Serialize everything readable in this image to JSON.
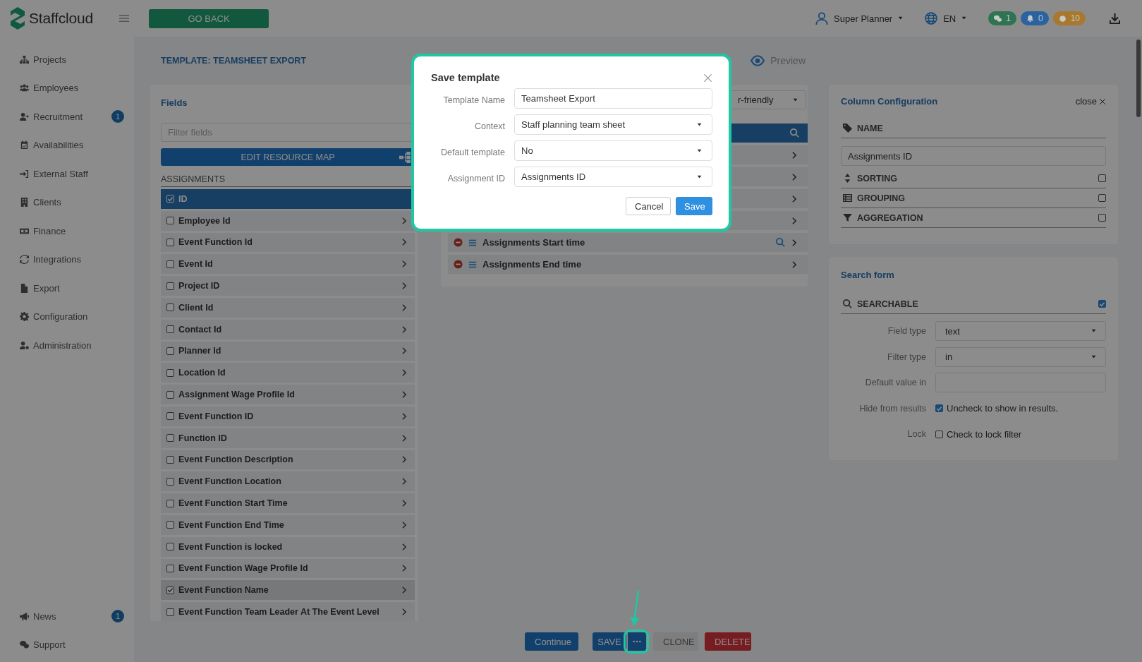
{
  "header": {
    "logo": "Staffcloud",
    "back_button": "GO BACK",
    "user": "Super Planner",
    "language": "EN",
    "counters": [
      {
        "kind": "chat",
        "label": "1",
        "color": "#2e7352"
      },
      {
        "kind": "bell",
        "label": "0",
        "color": "#2b62a0"
      },
      {
        "kind": "coin",
        "label": "10",
        "color": "#a8782c"
      }
    ]
  },
  "sidebar": {
    "items": [
      {
        "label": "Projects"
      },
      {
        "label": "Employees"
      },
      {
        "label": "Recruitment",
        "badge": "1"
      },
      {
        "label": "Availabilities"
      },
      {
        "label": "External Staff"
      },
      {
        "label": "Clients"
      },
      {
        "label": "Finance"
      },
      {
        "label": "Integrations"
      },
      {
        "label": "Export"
      },
      {
        "label": "Configuration"
      },
      {
        "label": "Administration"
      }
    ],
    "bottom_items": [
      {
        "label": "News",
        "badge": "1"
      },
      {
        "label": "Support"
      }
    ]
  },
  "page": {
    "title": "TEMPLATE: TEAMSHEET EXPORT",
    "preview_step": "Preview"
  },
  "fields": {
    "title": "Fields",
    "filter": {
      "placeholder": "Filter fields"
    },
    "edit_button": "EDIT RESOURCE MAP",
    "group": "ASSIGNMENTS",
    "items": [
      {
        "label": "ID",
        "checked": true,
        "selected": true
      },
      {
        "label": "Employee Id",
        "checked": false,
        "selected": false
      },
      {
        "label": "Event Function Id",
        "checked": false,
        "selected": false
      },
      {
        "label": "Event Id",
        "checked": false,
        "selected": false
      },
      {
        "label": "Project ID",
        "checked": false,
        "selected": false
      },
      {
        "label": "Client Id",
        "checked": false,
        "selected": false
      },
      {
        "label": "Contact Id",
        "checked": false,
        "selected": false
      },
      {
        "label": "Planner Id",
        "checked": false,
        "selected": false
      },
      {
        "label": "Location Id",
        "checked": false,
        "selected": false
      },
      {
        "label": "Assignment Wage Profile Id",
        "checked": false,
        "selected": false
      },
      {
        "label": "Event Function ID",
        "checked": false,
        "selected": false
      },
      {
        "label": "Function ID",
        "checked": false,
        "selected": false
      },
      {
        "label": "Event Function Description",
        "checked": false,
        "selected": false
      },
      {
        "label": "Event Function Location",
        "checked": false,
        "selected": false
      },
      {
        "label": "Event Function Start Time",
        "checked": false,
        "selected": false
      },
      {
        "label": "Event Function End Time",
        "checked": false,
        "selected": false
      },
      {
        "label": "Event Function is locked",
        "checked": false,
        "selected": false
      },
      {
        "label": "Event Function Wage Profile Id",
        "checked": false,
        "selected": false
      },
      {
        "label": "Event Function Name",
        "checked": true,
        "selected": false
      },
      {
        "label": "Event Function Team Leader At The Event Level",
        "checked": false,
        "selected": false
      }
    ]
  },
  "columns": {
    "view_select": "r-friendly",
    "rows": [
      {
        "selected": true,
        "searchable": true
      },
      {
        "selected": false,
        "searchable": false
      },
      {
        "selected": false,
        "searchable": false
      },
      {
        "selected": false,
        "searchable": false
      },
      {
        "selected": false,
        "searchable": false
      },
      {
        "label": "Assignments Start time",
        "selected": false,
        "searchable": true
      },
      {
        "label": "Assignments End time",
        "selected": false,
        "searchable": false
      }
    ]
  },
  "column_configuration": {
    "title": "Column Configuration",
    "close": "close",
    "name_label": "NAME",
    "name_value": "Assignments ID",
    "options": [
      {
        "label": "SORTING",
        "checked": false
      },
      {
        "label": "GROUPING",
        "checked": false
      },
      {
        "label": "AGGREGATION",
        "checked": false
      }
    ]
  },
  "search_form": {
    "title": "Search form",
    "searchable": {
      "label": "SEARCHABLE",
      "checked": true
    },
    "rows": [
      {
        "kind": "select",
        "label": "Field type",
        "value": "text"
      },
      {
        "kind": "select",
        "label": "Filter type",
        "value": "in"
      },
      {
        "kind": "input",
        "label": "Default value in"
      },
      {
        "kind": "checkbox",
        "label": "Hide from results",
        "text": "Uncheck to show in results.",
        "checked": true
      },
      {
        "kind": "checkbox",
        "label": "Lock",
        "text": "Check to lock filter",
        "checked": false
      }
    ]
  },
  "bottom_bar": {
    "buttons": [
      {
        "kind": "primary",
        "label": "Continue"
      },
      {
        "kind": "save",
        "label": "SAVE"
      },
      {
        "kind": "more",
        "highlighted": true
      },
      {
        "kind": "secondary",
        "label": "CLONE"
      },
      {
        "kind": "danger",
        "label": "DELETE"
      }
    ]
  },
  "modal": {
    "title": "Save template",
    "highlighted": true,
    "fields": [
      {
        "kind": "input",
        "label": "Template Name",
        "value": "Teamsheet Export"
      },
      {
        "kind": "select",
        "label": "Context",
        "value": "Staff planning team sheet"
      },
      {
        "kind": "select",
        "label": "Default template",
        "value": "No"
      },
      {
        "kind": "select",
        "label": "Assignment ID",
        "value": "Assignments ID"
      }
    ],
    "buttons": [
      {
        "kind": "secondary",
        "label": "Cancel"
      },
      {
        "kind": "primary",
        "label": "Save"
      }
    ]
  }
}
